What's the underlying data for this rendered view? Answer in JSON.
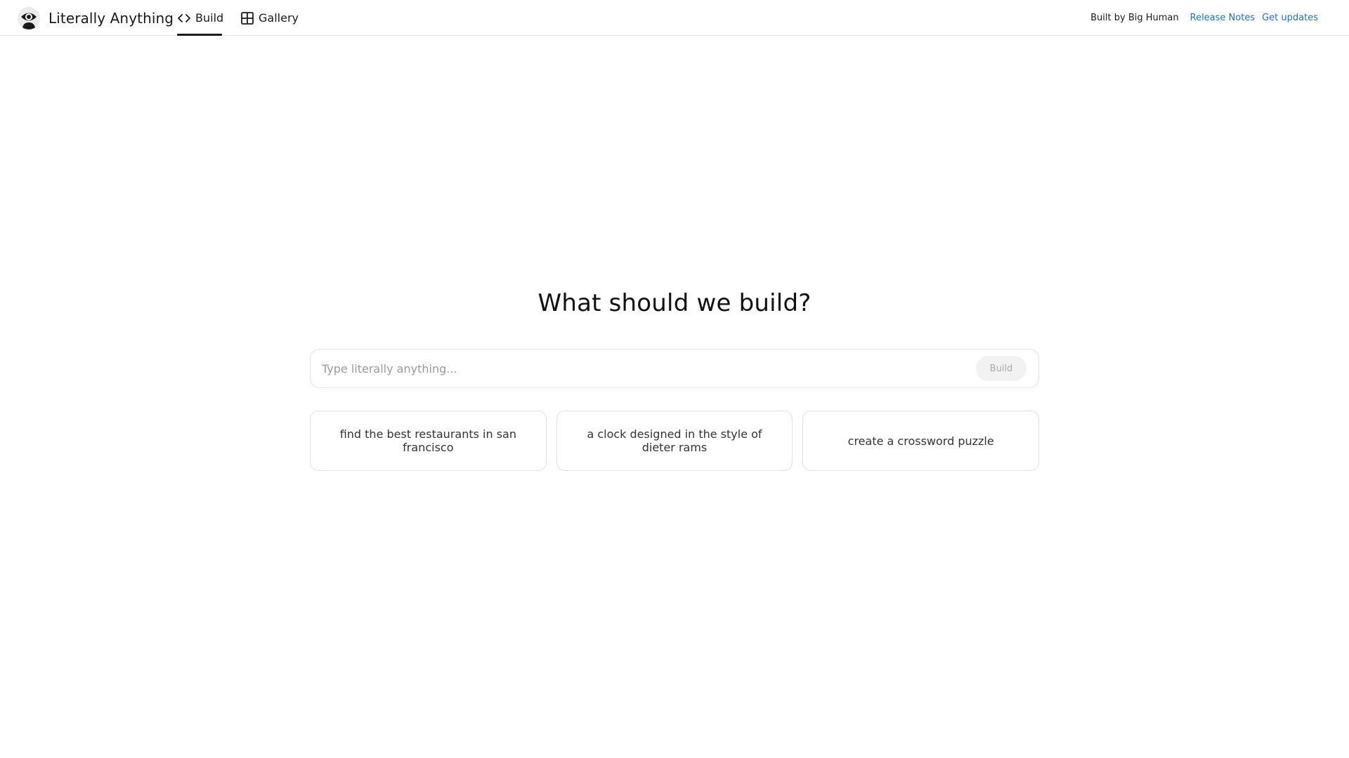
{
  "header": {
    "brand_name": "Literally Anything",
    "logo_icon": "eye-person-icon",
    "tabs": [
      {
        "label": "Build",
        "icon": "code-brackets-icon",
        "active": true
      },
      {
        "label": "Gallery",
        "icon": "grid-icon",
        "active": false
      }
    ],
    "built_by": "Built by Big Human",
    "links": [
      {
        "label": "Release Notes"
      },
      {
        "label": "Get updates"
      }
    ]
  },
  "main": {
    "headline": "What should we build?",
    "prompt": {
      "placeholder": "Type literally anything...",
      "value": "",
      "button_label": "Build"
    },
    "suggestions": [
      {
        "label": "find the best restaurants in san francisco"
      },
      {
        "label": "a clock designed in the style of dieter rams"
      },
      {
        "label": "create a crossword puzzle"
      }
    ]
  },
  "colors": {
    "link": "#1f6fc8",
    "border": "#e3e3e3",
    "text": "#1a1a1a"
  }
}
